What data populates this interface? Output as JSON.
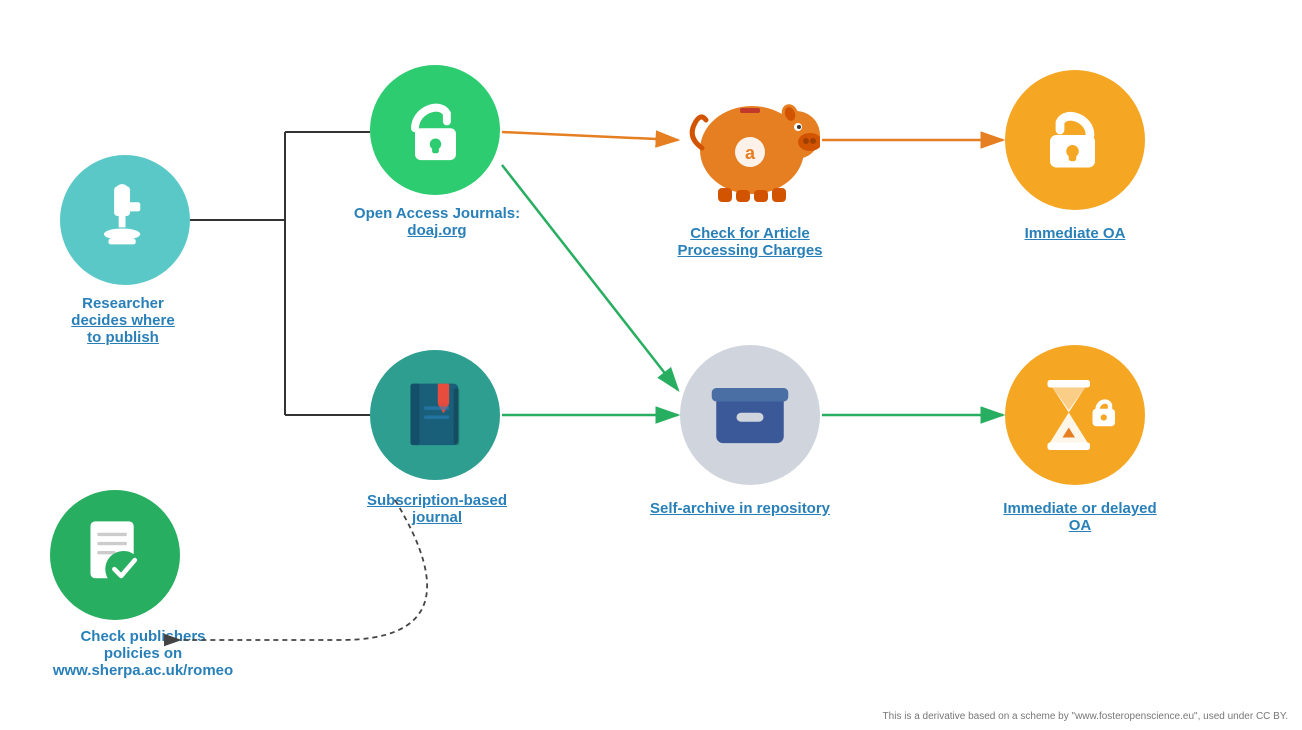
{
  "researcher": {
    "label_line1": "Researcher",
    "label_line2": "decides where",
    "label_line3": "to publish"
  },
  "oa_journal": {
    "label_line1": "Open Access Journals:",
    "label_line2": "doaj.org"
  },
  "sub_journal": {
    "label_line1": "Subscription-based",
    "label_line2": "journal"
  },
  "check_apc": {
    "label_line1": "Check for Article",
    "label_line2": "Processing Charges"
  },
  "repo": {
    "label": "Self-archive in repository"
  },
  "immediate_oa": {
    "label": "Immediate OA"
  },
  "delayed_oa": {
    "label_line1": "Immediate or delayed",
    "label_line2": "OA"
  },
  "check_publishers": {
    "label_line1": "Check publishers",
    "label_line2": "policies on",
    "label_line3": "www.sherpa.ac.uk/romeo"
  },
  "footer": {
    "text": "This is a derivative based on a scheme by \"www.fosteropenscience.eu\", used under CC BY."
  }
}
